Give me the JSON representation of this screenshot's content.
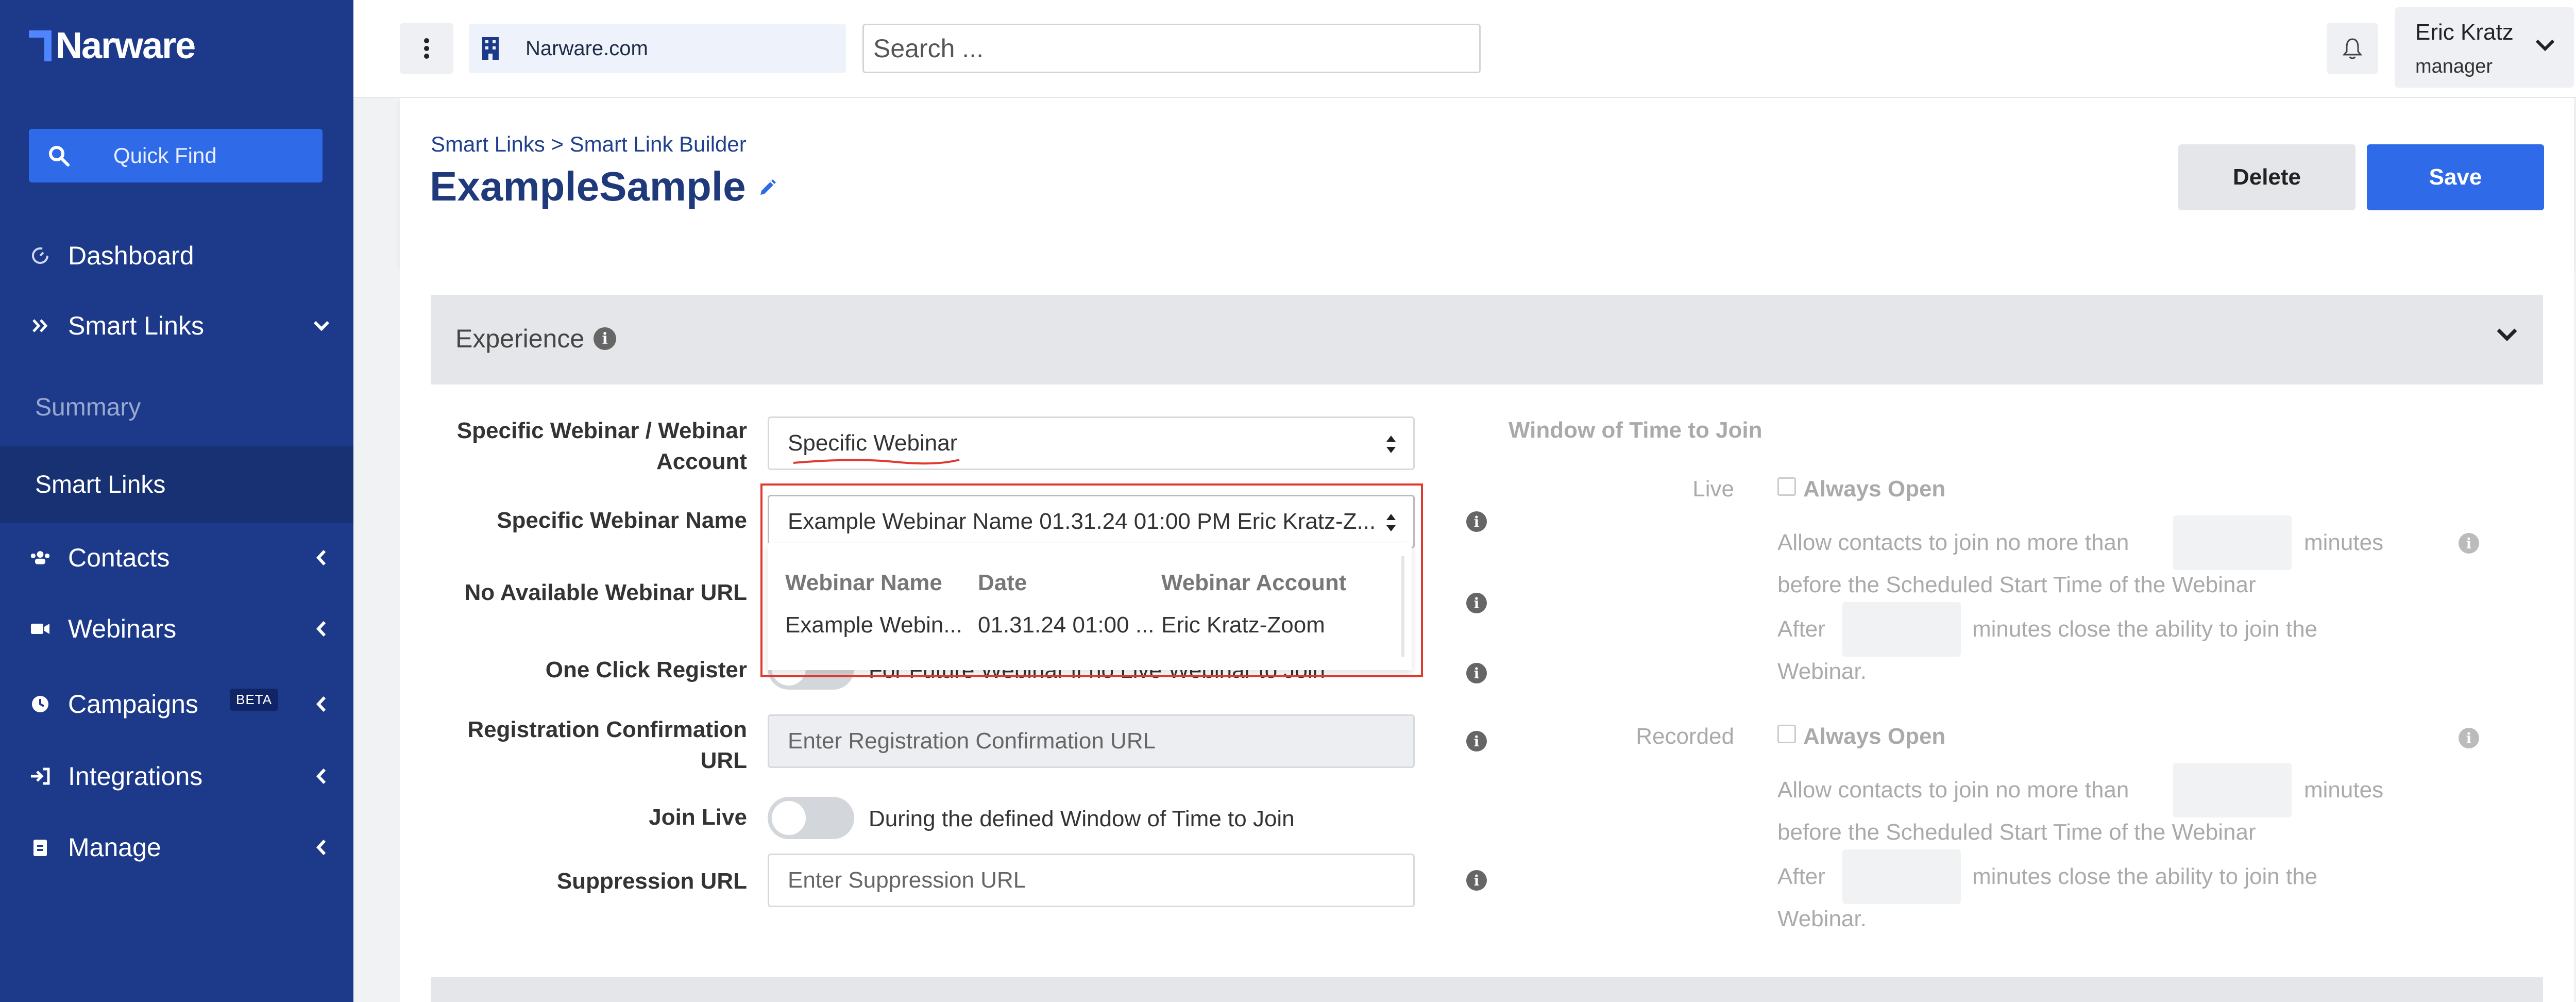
{
  "sidebar": {
    "brand": "Narware",
    "quick_find": "Quick Find",
    "items": [
      {
        "label": "Dashboard",
        "icon": "dashboard-icon"
      },
      {
        "label": "Smart Links",
        "icon": "double-chevron-icon"
      },
      {
        "label": "Contacts",
        "icon": "users-icon"
      },
      {
        "label": "Webinars",
        "icon": "video-icon"
      },
      {
        "label": "Campaigns",
        "icon": "clock-icon",
        "badge": "BETA"
      },
      {
        "label": "Integrations",
        "icon": "sign-in-icon"
      },
      {
        "label": "Manage",
        "icon": "clipboard-icon"
      }
    ],
    "sub_items": [
      {
        "label": "Summary"
      },
      {
        "label": "Smart Links"
      }
    ]
  },
  "topbar": {
    "domain": "Narware.com",
    "search_placeholder": "Search ...",
    "user_name": "Eric Kratz",
    "user_role": "manager"
  },
  "header": {
    "breadcrumb": "Smart Links > Smart Link Builder",
    "title": "ExampleSample",
    "delete_label": "Delete",
    "save_label": "Save"
  },
  "experience": {
    "section_title": "Experience",
    "fields": {
      "specific_webinar_account_label": "Specific Webinar / Webinar Account",
      "specific_webinar_account_value": "Specific Webinar",
      "specific_webinar_name_label": "Specific Webinar Name",
      "specific_webinar_name_value": "Example Webinar Name 01.31.24 01:00 PM Eric Kratz-Z...",
      "no_available_url_label": "No Available Webinar URL",
      "one_click_register_label": "One Click Register",
      "one_click_register_text": "For Future Webinar if no Live Webinar to Join",
      "registration_label": "Registration Confirmation URL",
      "registration_placeholder": "Enter Registration Confirmation URL",
      "join_live_label": "Join Live",
      "join_live_text": "During the defined Window of Time to Join",
      "suppression_label": "Suppression URL",
      "suppression_placeholder": "Enter Suppression URL"
    },
    "dropdown": {
      "headers": [
        "Webinar Name",
        "Date",
        "Webinar Account"
      ],
      "row": [
        "Example Webin...",
        "01.31.24 01:00 ...",
        "Eric Kratz-Zoom"
      ]
    },
    "window": {
      "title": "Window of Time to Join",
      "live_label": "Live",
      "recorded_label": "Recorded",
      "always_open": "Always Open",
      "before_line1a": "Allow contacts to join no more than",
      "minutes": "minutes",
      "before_line2": "before the Scheduled Start Time of the Webinar",
      "after": "After",
      "after_tail": "minutes close the ability to join the",
      "webinar_end": "Webinar."
    }
  },
  "colors": {
    "sidebar": "#1d3a8a",
    "accent": "#2f6ae8",
    "highlight_frame": "#e03a2f"
  }
}
